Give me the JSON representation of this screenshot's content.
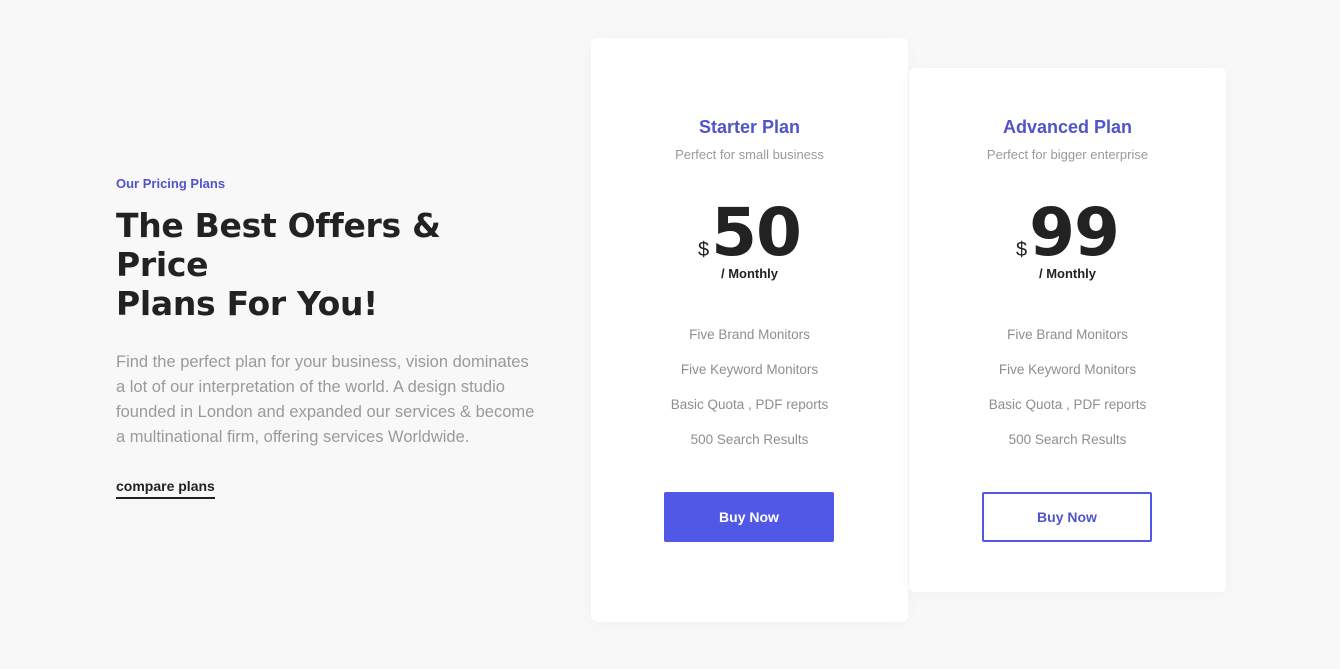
{
  "intro": {
    "eyebrow": "Our Pricing Plans",
    "headline_line1": "The Best Offers & Price",
    "headline_line2": "Plans For You!",
    "description": "Find the perfect plan for your business, vision dominates a lot of our interpretation of the world. A design studio founded in London and expanded our services & become a multinational firm, offering services Worldwide.",
    "compare_link": "compare plans"
  },
  "plans": [
    {
      "name": "Starter Plan",
      "subtitle": "Perfect for small business",
      "currency": "$",
      "price": "50",
      "period": "/ Monthly",
      "features": [
        "Five Brand Monitors",
        "Five Keyword Monitors",
        "Basic Quota , PDF reports",
        "500 Search Results"
      ],
      "button_label": "Buy Now",
      "button_style": "solid"
    },
    {
      "name": "Advanced Plan",
      "subtitle": "Perfect for bigger enterprise",
      "currency": "$",
      "price": "99",
      "period": "/ Monthly",
      "features": [
        "Five Brand Monitors",
        "Five Keyword Monitors",
        "Basic Quota , PDF reports",
        "500 Search Results"
      ],
      "button_label": "Buy Now",
      "button_style": "outline"
    }
  ],
  "colors": {
    "accent": "#5058e5",
    "accent_text": "#4f55c9",
    "heading": "#222222",
    "muted": "#9a9a9a",
    "background": "#f8f8f8",
    "card": "#ffffff"
  }
}
